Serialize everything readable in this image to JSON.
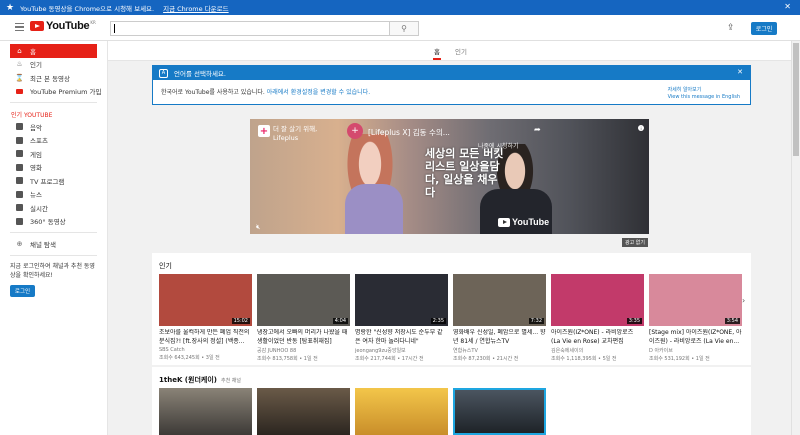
{
  "promo": {
    "text": "YouTube 동영상을 Chrome으로 시청해 보세요.",
    "link": "지금 Chrome 다운로드",
    "close": "✕"
  },
  "masthead": {
    "logo_text": "YouTube",
    "logo_region": "KR",
    "search_placeholder": "",
    "signin": "로그인"
  },
  "sidebar": {
    "main": [
      {
        "label": "홈",
        "icon": "home-icon",
        "glyph": "⌂"
      },
      {
        "label": "인기",
        "icon": "fire-icon",
        "glyph": "♨"
      },
      {
        "label": "최근 본 동영상",
        "icon": "hourglass-icon",
        "glyph": "⌛"
      },
      {
        "label": "YouTube Premium 가입",
        "icon": "youtube-premium-icon",
        "glyph": ""
      }
    ],
    "best_title": "인기 YOUTUBE",
    "best": [
      {
        "label": "음악",
        "glyph": "♫"
      },
      {
        "label": "스포츠",
        "glyph": "⚽"
      },
      {
        "label": "게임",
        "glyph": "▣"
      },
      {
        "label": "영화",
        "glyph": "▤"
      },
      {
        "label": "TV 프로그램",
        "glyph": "▭"
      },
      {
        "label": "뉴스",
        "glyph": "▦"
      },
      {
        "label": "실시간",
        "glyph": "◉"
      },
      {
        "label": "360° 동영상",
        "glyph": "◎"
      }
    ],
    "browse": "채널 탐색",
    "signin_msg": "지금 로그인하여 채널과 추천 동영상을 확인하세요!",
    "signin_button": "로그인"
  },
  "tabs": [
    "홈",
    "인기"
  ],
  "lang_banner": {
    "title": "언어를 선택하세요.",
    "message": "한국어로 YouTube를 사용하고 있습니다.",
    "link": "아래에서 환경설정을 변경할 수 있습니다.",
    "right_line1": "자세히 알아보기",
    "right_line2": "View this message in English"
  },
  "hero": {
    "left_text_1": "더 잘 살기 위해,",
    "left_text_2": "Lifeplus",
    "video_title": "[Lifeplus X] 김동 수의...",
    "watch_later": "나중에 시청하기",
    "overlay_korean": "세상의 모든 버킷리스트 일상을담다, 일상을 채우다",
    "share": "➦",
    "watermark": "YouTube",
    "ad_label": "광고 없기"
  },
  "shelf": {
    "title": "인기",
    "cards": [
      {
        "title": "조보아를 울컥하게 만든 폐업 직전의 분식집?! [ft.장사의 정설] (백종...",
        "channel": "SBS Catch",
        "meta": "조회수 643,245회 • 3일 전",
        "duration": "15:02",
        "bg": "#b24a3e"
      },
      {
        "title": "냉장고에서 오빠의 머리가 나왔을 때 생활이었던 반동 [탐표취재집]",
        "channel": "공감 JUNHOO 88",
        "meta": "조회수 813,758회 • 1일 전",
        "duration": "4:04",
        "bg": "#5c5a55"
      },
      {
        "title": "명랑한 \"신성향 저장시도 순두부 같은 여자 한마 놀러다니네\"",
        "channel": "jeongang9zu중앙일보",
        "meta": "조회수 217,744회 • 17시간 전",
        "duration": "2:35",
        "bg": "#2a2c34"
      },
      {
        "title": "영화배우 신성일, 폐암으로 별세... 향년 81세 / 연합뉴스TV",
        "channel": "연합뉴스TV",
        "meta": "조회수 87,230회 • 21시간 전",
        "duration": "7:32",
        "bg": "#6d6458"
      },
      {
        "title": "아이즈원(IZ*ONE) - 라비앙로즈 (La Vie en Rose) 교차편집(stage...",
        "channel": "김은숙에세이의",
        "meta": "조회수 1,118,395회 • 5일 전",
        "duration": "3:35",
        "bg": "#c23a6a"
      },
      {
        "title": "[Stage mix] 아이즈원(IZ*ONE, 아이즈원) - 라비앙로즈 (La Vie en...",
        "channel": "D 아카이브",
        "meta": "조회수 531,192회 • 1일 전",
        "duration": "3:54",
        "bg": "#d8899b"
      }
    ]
  },
  "shelf2": {
    "title": "1theK (원더케이)",
    "subtitle": "추천 채널"
  },
  "colors": {
    "brand_red": "#e62117",
    "blue": "#167ac6",
    "promo_blue": "#1565c0"
  }
}
